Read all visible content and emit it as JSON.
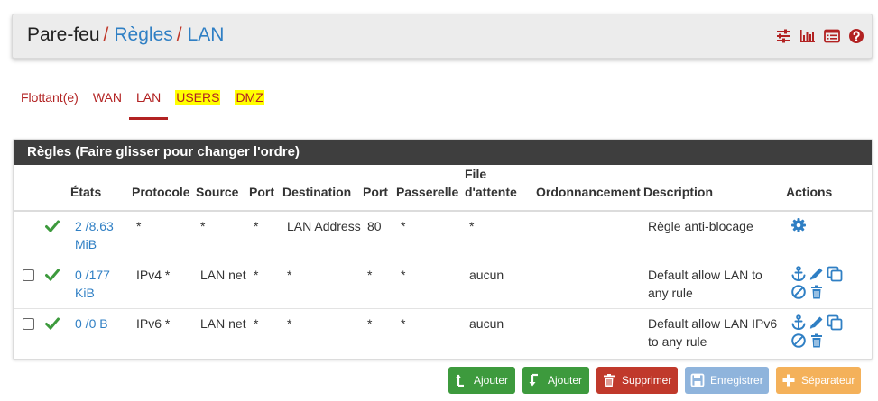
{
  "breadcrumb": {
    "root": "Pare-feu",
    "sep": "/",
    "level1": "Règles",
    "level2": "LAN"
  },
  "header_icons": [
    "sliders-icon",
    "bar-chart-icon",
    "list-table-icon",
    "help-icon"
  ],
  "tabs": [
    {
      "label": "Flottant(e)",
      "active": false,
      "highlighted": false
    },
    {
      "label": "WAN",
      "active": false,
      "highlighted": false
    },
    {
      "label": "LAN",
      "active": true,
      "highlighted": false
    },
    {
      "label": "USERS",
      "active": false,
      "highlighted": true
    },
    {
      "label": "DMZ",
      "active": false,
      "highlighted": true
    }
  ],
  "panel": {
    "title": "Règles (Faire glisser pour changer l'ordre)"
  },
  "table": {
    "headers": [
      "États",
      "Protocole",
      "Source",
      "Port",
      "Destination",
      "Port",
      "Passerelle",
      "File d'attente",
      "Ordonnancement",
      "Description",
      "Actions"
    ],
    "rows": [
      {
        "states": "2 /8.63 MiB",
        "protocol": "*",
        "source": "*",
        "port": "*",
        "destination": "LAN Address",
        "dport": "80",
        "gateway": "*",
        "queue": "*",
        "schedule": "",
        "description": "Règle anti-blocage"
      },
      {
        "states": "0 /177 KiB",
        "protocol": "IPv4 *",
        "source": "LAN net",
        "port": "*",
        "destination": "*",
        "dport": "*",
        "gateway": "*",
        "queue": "aucun",
        "schedule": "",
        "description": "Default allow LAN to any rule"
      },
      {
        "states": "0 /0 B",
        "protocol": "IPv6 *",
        "source": "LAN net",
        "port": "*",
        "destination": "*",
        "dport": "*",
        "gateway": "*",
        "queue": "aucun",
        "schedule": "",
        "description": "Default allow LAN IPv6 to any rule"
      }
    ]
  },
  "buttons": {
    "add_top": "Ajouter",
    "add_bottom": "Ajouter",
    "delete": "Supprimer",
    "save": "Enregistrer",
    "separator": "Séparateur"
  },
  "colors": {
    "accent_red": "#b22222",
    "link_blue": "#2f7fc4",
    "green": "#3d9a3d",
    "dark_header": "#3e3e3e",
    "highlight": "#ffff00"
  }
}
